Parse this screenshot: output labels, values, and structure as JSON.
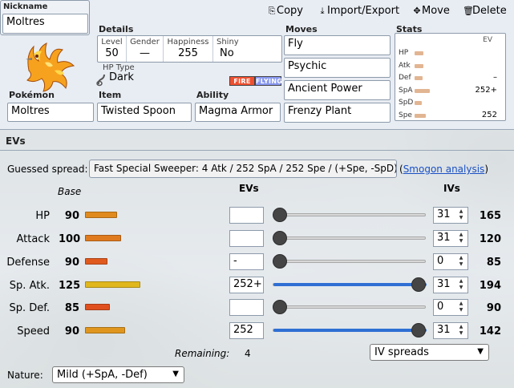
{
  "header": {
    "nickname_label": "Nickname",
    "nickname_value": "Moltres",
    "actions": [
      {
        "icon": "copy-icon",
        "label": "Copy"
      },
      {
        "icon": "import-export-icon",
        "label": "Import/Export"
      },
      {
        "icon": "move-icon",
        "label": "Move"
      },
      {
        "icon": "delete-icon",
        "label": "Delete"
      }
    ]
  },
  "details": {
    "heading": "Details",
    "level_label": "Level",
    "level_value": "50",
    "gender_label": "Gender",
    "gender_value": "—",
    "happiness_label": "Happiness",
    "happiness_value": "255",
    "shiny_label": "Shiny",
    "shiny_value": "No",
    "hp_type_label": "HP Type",
    "hp_type_value": "Dark",
    "types": [
      {
        "name": "FIRE",
        "color": "#f05030"
      },
      {
        "name": "FLYING",
        "color": "#8898f0"
      }
    ]
  },
  "fields": {
    "pokemon_label": "Pokémon",
    "pokemon_value": "Moltres",
    "item_label": "Item",
    "item_value": "Twisted Spoon",
    "ability_label": "Ability",
    "ability_value": "Magma Armor"
  },
  "moves": {
    "heading": "Moves",
    "list": [
      "Fly",
      "Psychic",
      "Ancient Power",
      "Frenzy Plant"
    ]
  },
  "stats_summary": {
    "heading": "Stats",
    "ev_label": "EV",
    "rows": [
      {
        "name": "HP",
        "ev": "",
        "bar": 0.42
      },
      {
        "name": "Atk",
        "ev": "",
        "bar": 0.42
      },
      {
        "name": "Def",
        "ev": "–",
        "bar": 0.38
      },
      {
        "name": "SpA",
        "ev": "252+",
        "bar": 0.72
      },
      {
        "name": "SpD",
        "ev": "",
        "bar": 0.33
      },
      {
        "name": "Spe",
        "ev": "252",
        "bar": 0.55
      }
    ]
  },
  "evs": {
    "heading": "EVs",
    "guessed_label": "Guessed spread:",
    "guessed_value": "Fast Special Sweeper: 4 Atk / 252 SpA / 252 Spe / (+Spe, -SpD)",
    "smogon_link": "Smogon analysis",
    "col_base": "Base",
    "col_evs": "EVs",
    "col_ivs": "IVs",
    "rows": [
      {
        "stat": "HP",
        "base": "90",
        "base_bar": 0.36,
        "bar_color": "#e08a1e",
        "ev": "",
        "ev_fill": 0.0,
        "iv": "31",
        "total": "165"
      },
      {
        "stat": "Attack",
        "base": "100",
        "base_bar": 0.4,
        "bar_color": "#e07a1e",
        "ev": "",
        "ev_fill": 0.0,
        "iv": "31",
        "total": "120"
      },
      {
        "stat": "Defense",
        "base": "90",
        "base_bar": 0.25,
        "bar_color": "#e05a1e",
        "ev": "-",
        "ev_fill": 0.0,
        "iv": "0",
        "total": "85"
      },
      {
        "stat": "Sp. Atk.",
        "base": "125",
        "base_bar": 0.62,
        "bar_color": "#e0b81e",
        "ev": "252+",
        "ev_fill": 1.0,
        "iv": "31",
        "total": "194"
      },
      {
        "stat": "Sp. Def.",
        "base": "85",
        "base_bar": 0.28,
        "bar_color": "#e0501e",
        "ev": "",
        "ev_fill": 0.0,
        "iv": "0",
        "total": "90"
      },
      {
        "stat": "Speed",
        "base": "90",
        "base_bar": 0.45,
        "bar_color": "#e0961e",
        "ev": "252",
        "ev_fill": 1.0,
        "iv": "31",
        "total": "142"
      }
    ],
    "remaining_label": "Remaining:",
    "remaining_value": "4",
    "iv_spreads_value": "IV spreads",
    "nature_label": "Nature:",
    "nature_value": "Mild (+SpA, -Def)"
  }
}
